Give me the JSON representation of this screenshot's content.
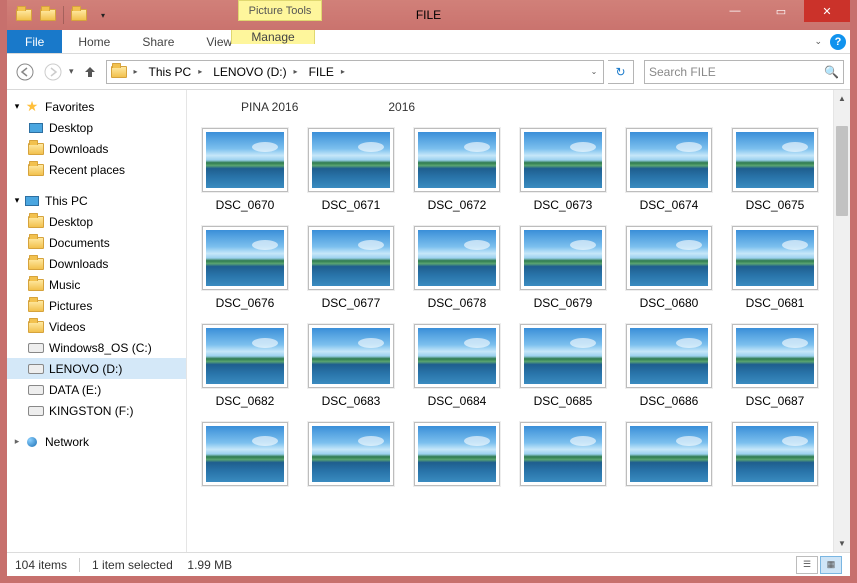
{
  "window": {
    "contextual_tab": "Picture Tools",
    "title": "FILE"
  },
  "ribbon": {
    "tabs": {
      "file": "File",
      "home": "Home",
      "share": "Share",
      "view": "View",
      "manage": "Manage"
    }
  },
  "address": {
    "segments": [
      "This PC",
      "LENOVO (D:)",
      "FILE"
    ]
  },
  "search": {
    "placeholder": "Search FILE"
  },
  "tree": {
    "favorites": {
      "label": "Favorites",
      "items": [
        "Desktop",
        "Downloads",
        "Recent places"
      ]
    },
    "thispc": {
      "label": "This PC",
      "items": [
        "Desktop",
        "Documents",
        "Downloads",
        "Music",
        "Pictures",
        "Videos",
        "Windows8_OS (C:)",
        "LENOVO (D:)",
        "DATA (E:)",
        "KINGSTON (F:)"
      ]
    },
    "network": {
      "label": "Network"
    }
  },
  "topfolders": [
    "PINA 2016",
    "2016"
  ],
  "files": [
    "DSC_0670",
    "DSC_0671",
    "DSC_0672",
    "DSC_0673",
    "DSC_0674",
    "DSC_0675",
    "DSC_0676",
    "DSC_0677",
    "DSC_0678",
    "DSC_0679",
    "DSC_0680",
    "DSC_0681",
    "DSC_0682",
    "DSC_0683",
    "DSC_0684",
    "DSC_0685",
    "DSC_0686",
    "DSC_0687"
  ],
  "status": {
    "count": "104 items",
    "selection": "1 item selected",
    "size": "1.99 MB"
  }
}
